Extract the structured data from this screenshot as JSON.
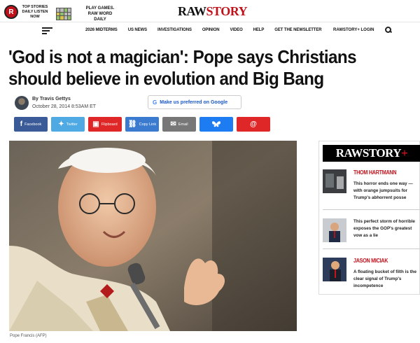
{
  "promo": {
    "top_stories": "TOP STORIES DAILY LISTEN NOW",
    "play_games": "PLAY GAMES. RAW WORD DAILY"
  },
  "logo": {
    "part1": "RAW",
    "part2": "STORY"
  },
  "nav": {
    "items": [
      "2026 MIDTERMS",
      "US NEWS",
      "INVESTIGATIONS",
      "OPINION",
      "VIDEO",
      "HELP",
      "GET THE NEWSLETTER"
    ],
    "login": "RAWSTORY+ LOGIN"
  },
  "article": {
    "headline": "'God is not a magician': Pope says Christians should believe in evolution and Big Bang",
    "author": "By Travis Gettys",
    "date": "October 28, 2014 8:53AM ET",
    "preferred_label": "Make us preferred on Google",
    "caption": "Pope Francis (AFP)"
  },
  "share": {
    "facebook": "Facebook",
    "twitter": "Twitter",
    "flipboard": "Flipboard",
    "copy": "Copy Link",
    "email": "Email"
  },
  "sidebar": {
    "logo_main": "RAWSTORY",
    "logo_plus": "+",
    "items": [
      {
        "author": "THOM HARTMANN",
        "title": "This horror ends one way — with orange jumpsuits for Trump's abhorrent posse"
      },
      {
        "author": "",
        "title": "This perfect storm of horrible exposes the GOP's greatest vow as a lie"
      },
      {
        "author": "JASON MICIAK",
        "title": "A floating bucket of filth is the clear signal of Trump's incompetence"
      }
    ]
  }
}
